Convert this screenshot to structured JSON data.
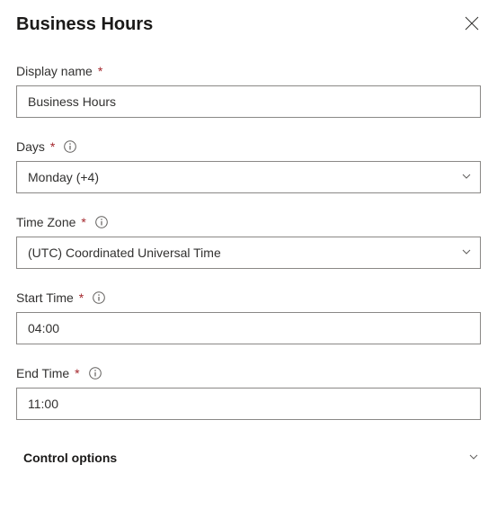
{
  "header": {
    "title": "Business Hours"
  },
  "fields": {
    "displayName": {
      "label": "Display name",
      "value": "Business Hours"
    },
    "days": {
      "label": "Days",
      "value": "Monday (+4)"
    },
    "timeZone": {
      "label": "Time Zone",
      "value": "(UTC) Coordinated Universal Time"
    },
    "startTime": {
      "label": "Start Time",
      "value": "04:00"
    },
    "endTime": {
      "label": "End Time",
      "value": "11:00"
    }
  },
  "controlOptions": {
    "label": "Control options"
  }
}
